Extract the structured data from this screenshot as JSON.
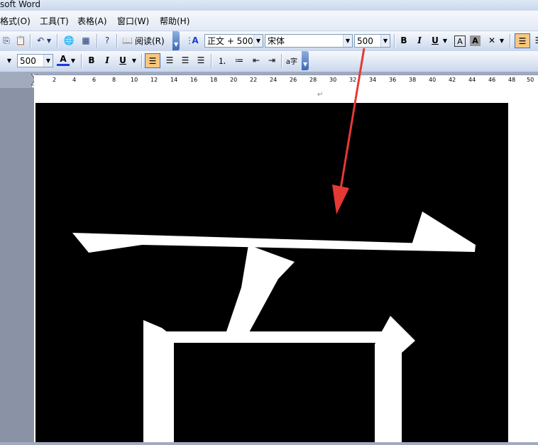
{
  "window": {
    "title": "soft Word"
  },
  "menu": [
    {
      "label": "格式(O)"
    },
    {
      "label": "工具(T)"
    },
    {
      "label": "表格(A)"
    },
    {
      "label": "窗口(W)"
    },
    {
      "label": "帮助(H)"
    }
  ],
  "toolbar1": {
    "read_label": "阅读(R)",
    "style_value": "正文 + 500",
    "font_value": "宋体",
    "size_value": "500"
  },
  "toolbar2": {
    "size_value": "500"
  },
  "ruler": {
    "ticks": [
      "2",
      "4",
      "6",
      "8",
      "10",
      "12",
      "14",
      "16",
      "18",
      "20",
      "22",
      "24",
      "26",
      "28",
      "30",
      "32",
      "34",
      "36",
      "38",
      "40",
      "42",
      "44",
      "46",
      "48",
      "50"
    ]
  },
  "document": {
    "paragraph_mark": "↵",
    "glyph_description_icon": "large-white-character-glyph"
  },
  "annotation": {
    "color": "#e53935"
  },
  "colors": {
    "accent": "#f7c782",
    "font_color_underline": "#1a3dd6"
  }
}
